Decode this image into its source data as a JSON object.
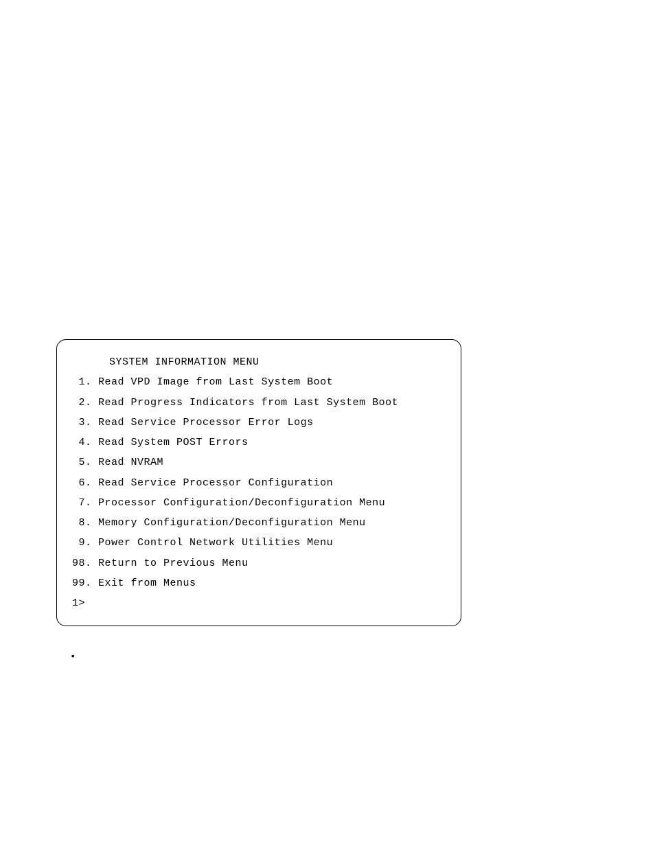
{
  "menu": {
    "title": "SYSTEM INFORMATION MENU",
    "items": [
      {
        "num": " 1",
        "label": "Read VPD Image from Last System Boot"
      },
      {
        "num": " 2",
        "label": "Read Progress Indicators from Last System Boot"
      },
      {
        "num": " 3",
        "label": "Read Service Processor Error Logs"
      },
      {
        "num": " 4",
        "label": "Read System POST Errors"
      },
      {
        "num": " 5",
        "label": "Read NVRAM"
      },
      {
        "num": " 6",
        "label": "Read Service Processor Configuration"
      },
      {
        "num": " 7",
        "label": "Processor Configuration/Deconfiguration Menu"
      },
      {
        "num": " 8",
        "label": "Memory Configuration/Deconfiguration Menu"
      },
      {
        "num": " 9",
        "label": "Power Control Network Utilities Menu"
      },
      {
        "num": "98",
        "label": "Return to Previous Menu"
      },
      {
        "num": "99",
        "label": "Exit from Menus"
      }
    ],
    "prompt": "1>"
  },
  "bullet": "•"
}
